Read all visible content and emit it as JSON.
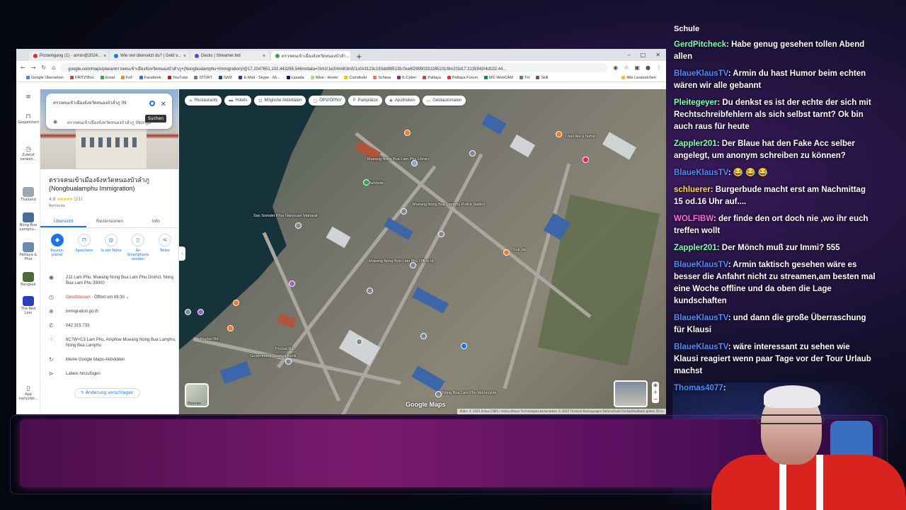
{
  "browser": {
    "tabs": [
      {
        "label": "Posteingang (1) - armin@2024..."
      },
      {
        "label": "Wie viel übersetzt du? | Geld v..."
      },
      {
        "label": "Decks | Streamer.bot"
      },
      {
        "label": "ตรวจคนเข้าเมืองจังหวัดหนองบัวลำ..."
      }
    ],
    "url": "google.com/maps/place/ตรวจคนเข้าเมืองจังหวัดหนองบัวลำภู+(Nongbualamphu+Immigration)/@17.2047651,102.443265,546m/data=!3m1!1e3!4m6!3m5!1s0x3123c193dd99513b:0xe6f29990331185101!8m2!3d17.2135943!4d102.44...",
    "bookmarks": [
      "Google Übersetzer",
      "FRITZ!Box",
      "fonial",
      "FoF",
      "Facebook",
      "YouTube",
      "STORT",
      "GMX",
      "E-Mail - Skype - Mi...",
      "Lazada",
      "Wise - Home",
      "Comdirekt",
      "Schiwa",
      "K-Cyber",
      "Pattaya",
      "Pattaya Forum",
      "MC-WebCAM",
      "TH",
      "Skill",
      "Alle Lesezeichen"
    ]
  },
  "sidebar": {
    "items": [
      {
        "label": "Gespeichert",
        "icon": "bookmark-icon"
      },
      {
        "label": "Zuletzt verwen...",
        "icon": "history-icon"
      },
      {
        "label": "Thailand"
      },
      {
        "label": "Nong Bua Lamphu..."
      },
      {
        "label": "Pattaya & Phia"
      },
      {
        "label": "Bangkok"
      },
      {
        "label": "The Red Lion"
      },
      {
        "label": "App herunter..."
      }
    ]
  },
  "panel": {
    "search_line1": "ตรวจคนเข้าเมืองจังหวัดหนองบัวลำภู (N",
    "search_line2": "ตรวจคนเข้าเมืองจังหวัดหนองบัวลำภู (Nongbu",
    "tooltip": "Suchen",
    "title": "ตรวจคนเข้าเมืองจังหวัดหนองบัวลำภู (Nongbualamphu Immigration)",
    "rating": "4,9",
    "stars": "★★★★★",
    "review_count": "(21)",
    "category": "Behörde",
    "tabs": [
      "Übersicht",
      "Rezensionen",
      "Info"
    ],
    "actions": [
      {
        "label": "Routen-planer",
        "icon": "directions-icon"
      },
      {
        "label": "Speichern",
        "icon": "bookmark-icon"
      },
      {
        "label": "In der Nähe",
        "icon": "nearby-icon"
      },
      {
        "label": "An Smartphone senden",
        "icon": "phone-icon"
      },
      {
        "label": "Teilen",
        "icon": "share-icon"
      }
    ],
    "address": "211 Lam Phu, Mueang Nong Bua Lam Phu District, Nong Bua Lam Phu 39000",
    "hours_status": "Geschlossen",
    "hours_open": " · Öffnet um 08:30",
    "website": "immigration.go.th",
    "phone": "042 315 733",
    "plus_code": "6C7W+C3 Lam Phu, Amphoe Mueang Nong Bua Lamphu, Nong Bua Lamphu",
    "maps_activity": "Meine Google Maps-Aktivitäten",
    "labels": "Labels hinzufügen",
    "suggest": "Änderung vorschlagen"
  },
  "map": {
    "chips": [
      {
        "label": "Restaurants",
        "icon": "restaurant-icon"
      },
      {
        "label": "Hotels",
        "icon": "hotel-icon"
      },
      {
        "label": "Mögliche Aktivitäten",
        "icon": "activity-icon"
      },
      {
        "label": "ÖPV/ÖPNV",
        "icon": "transit-icon"
      },
      {
        "label": "Parkplätze",
        "icon": "parking-icon"
      },
      {
        "label": "Apotheken",
        "icon": "pharmacy-icon"
      },
      {
        "label": "Geldautomaten",
        "icon": "atm-icon"
      }
    ],
    "labels": [
      {
        "text": "Mueang Nong Bua Lam Phu Library"
      },
      {
        "text": "San Somdet Phra Naresuan Maharat"
      },
      {
        "text": "Mueang Nong Bua Lamphu Police Station"
      },
      {
        "text": "Mueang Nong Bua Lam Phu Office of..."
      },
      {
        "text": "Government Savings Bank"
      },
      {
        "text": "Nong Bua Lam Phu Motorcycle"
      },
      {
        "text": "Pochai Rd"
      },
      {
        "text": "Pochai Rd"
      },
      {
        "text": "I feel like a home"
      },
      {
        "text": "Suk Jai"
      },
      {
        "text": "Behörde"
      }
    ],
    "layers_label": "Ebenen",
    "logo": "Google Maps",
    "copyright": "Bilder © 2025 Airbus,CNES / Airbus,Maxar Technologies,Kartendaten © 2025   Thailand   Bedingungen   Datenschutz   Produktfeedback geben   50 m"
  },
  "chat": {
    "top": "Schule",
    "messages": [
      {
        "user": "GerdPitcheck",
        "color": "#7fffb0",
        "text": ": Habe genug gesehen tollen Abend allen"
      },
      {
        "user": "BlaueKlausTV",
        "color": "#4b8cff",
        "text": ": Armin du hast Humor beim echten wären wir alle gebannt"
      },
      {
        "user": "Pleitegeyer",
        "color": "#7fffb0",
        "text": ": Du denkst es ist der echte der sich mit Rechtschreibfehlern als sich selbst tarnt? Ok bin auch raus für heute"
      },
      {
        "user": "Zappler201",
        "color": "#7fffb0",
        "text": ": Der Blaue hat den Fake Acc selber angelegt, um anonym schreiben zu können?"
      },
      {
        "user": "BlaueKlausTV",
        "color": "#4b8cff",
        "text": ": 😂 😂 😂"
      },
      {
        "user": "schluerer",
        "color": "#ffd84b",
        "text": ": Burgerbude macht erst am Nachmittag 15 od.16 Uhr auf...."
      },
      {
        "user": "WOLFIBW",
        "color": "#ff6bd5",
        "text": ": der finde den ort doch nie ,wo ihr euch treffen wollt"
      },
      {
        "user": "Zappler201",
        "color": "#7fffb0",
        "text": ": Der Mönch muß zur Immi? 555"
      },
      {
        "user": "BlaueKlausTV",
        "color": "#4b8cff",
        "text": ": Armin taktisch gesehen wäre es besser die Anfahrt nicht zu streamen,am besten mal eine Woche offline und da oben die Lage kundschaften"
      },
      {
        "user": "BlaueKlausTV",
        "color": "#4b8cff",
        "text": ": und dann die große Überraschung für Klausi"
      },
      {
        "user": "BlaueKlausTV",
        "color": "#4b8cff",
        "text": ": wäre interessant zu sehen wie Klausi reagiert wenn paar Tage vor der Tour Urlaub machst"
      },
      {
        "user": "Thomas4077",
        "color": "#4b8cff",
        "text": ":"
      }
    ]
  }
}
